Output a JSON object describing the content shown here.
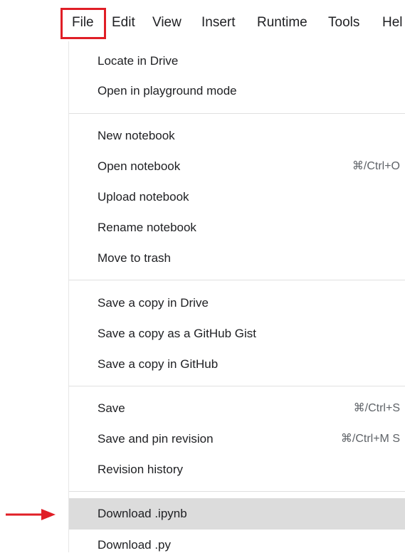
{
  "menubar": {
    "file": "File",
    "edit": "Edit",
    "view": "View",
    "insert": "Insert",
    "runtime": "Runtime",
    "tools": "Tools",
    "help": "Hel"
  },
  "file_menu": {
    "locate_in_drive": "Locate in Drive",
    "open_playground": "Open in playground mode",
    "new_notebook": "New notebook",
    "open_notebook": "Open notebook",
    "open_notebook_shortcut": "⌘/Ctrl+O",
    "upload_notebook": "Upload notebook",
    "rename_notebook": "Rename notebook",
    "move_to_trash": "Move to trash",
    "save_copy_drive": "Save a copy in Drive",
    "save_copy_gist": "Save a copy as a GitHub Gist",
    "save_copy_github": "Save a copy in GitHub",
    "save": "Save",
    "save_shortcut": "⌘/Ctrl+S",
    "save_pin_revision": "Save and pin revision",
    "save_pin_revision_shortcut": "⌘/Ctrl+M S",
    "revision_history": "Revision history",
    "download_ipynb": "Download .ipynb",
    "download_py": "Download .py"
  },
  "annotation": {
    "highlight_color": "#e01e26",
    "arrow_target": "download-ipynb-item"
  },
  "colors": {
    "hover_bg": "#dcdcdc",
    "divider": "#e0e0e0",
    "text": "#202124",
    "shortcut_text": "#5f6368"
  }
}
